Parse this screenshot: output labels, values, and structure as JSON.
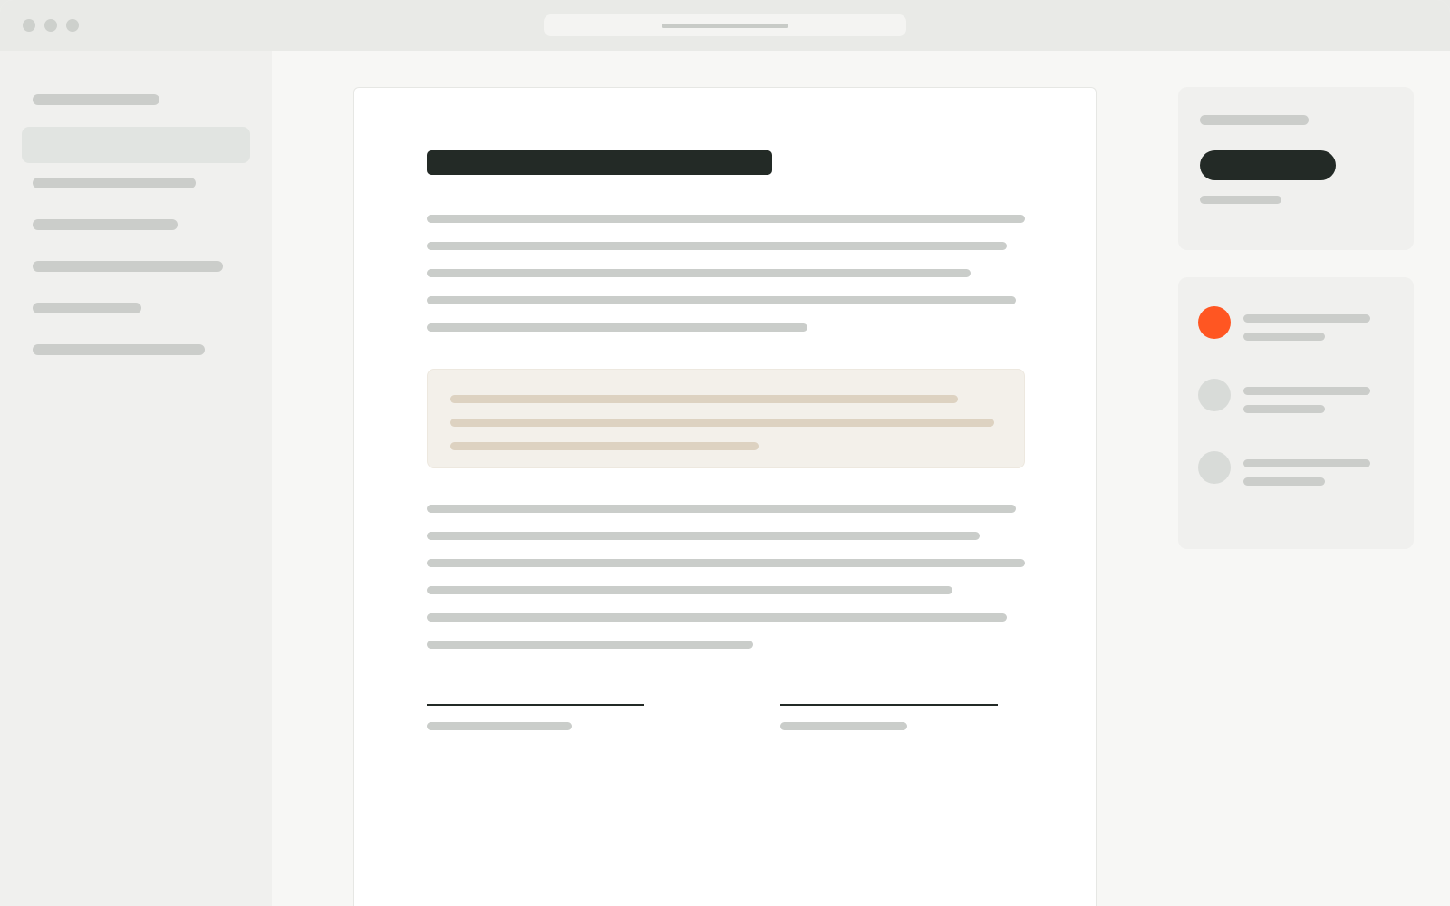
{
  "window": {
    "title_bar": {
      "address_bar_text": ""
    },
    "traffic_lights": [
      "close",
      "minimize",
      "zoom"
    ]
  },
  "sidebar": {
    "items": [
      {
        "label": "",
        "selected": false
      },
      {
        "label": "",
        "selected": true
      },
      {
        "label": "",
        "selected": false
      },
      {
        "label": "",
        "selected": false
      },
      {
        "label": "",
        "selected": false
      },
      {
        "label": "",
        "selected": false
      },
      {
        "label": "",
        "selected": false
      }
    ]
  },
  "document": {
    "title": "",
    "intro_paragraph_lines": 5,
    "callout_lines": 3,
    "body_paragraph_lines": 6,
    "signatures": [
      {
        "caption": ""
      },
      {
        "caption": ""
      }
    ]
  },
  "right_panel": {
    "summary_card": {
      "label": "",
      "button_label": "",
      "sub_label": ""
    },
    "participants": [
      {
        "name": "",
        "detail": "",
        "status": "active"
      },
      {
        "name": "",
        "detail": "",
        "status": "inactive"
      },
      {
        "name": "",
        "detail": "",
        "status": "inactive"
      }
    ]
  },
  "colors": {
    "accent": "#ff5622",
    "ink": "#232a26",
    "placeholder": "#cacdca",
    "callout_background": "#f3f0ea",
    "callout_text": "#ddd2c1",
    "background": "#f7f7f5"
  }
}
